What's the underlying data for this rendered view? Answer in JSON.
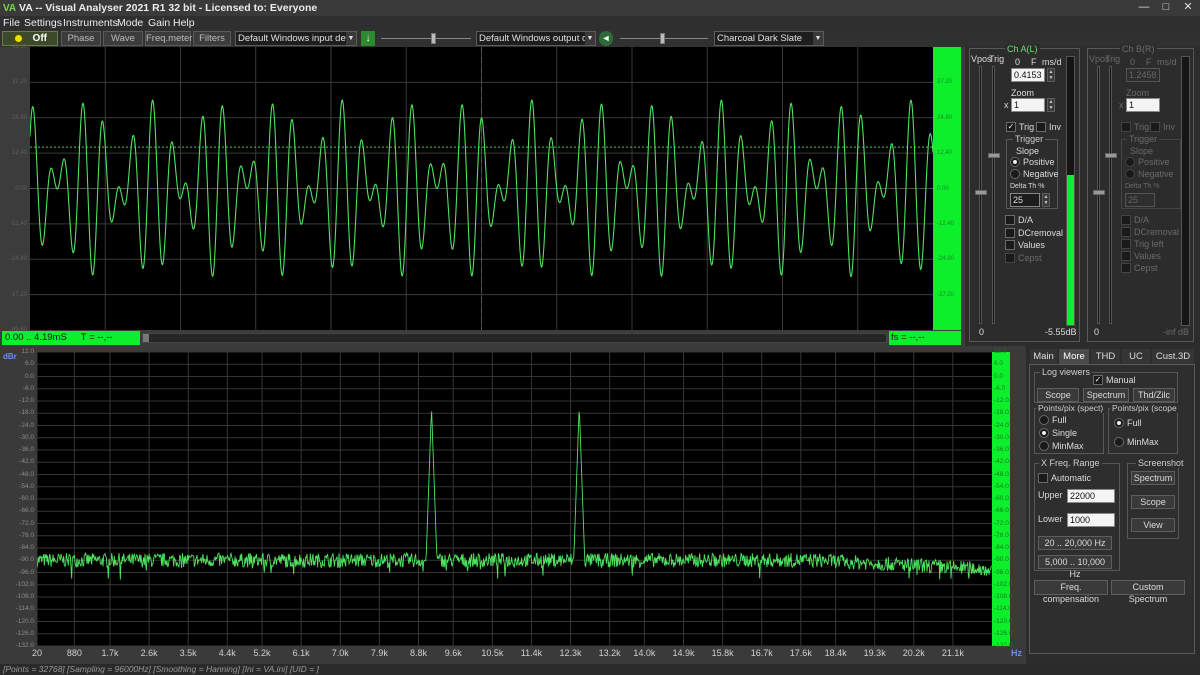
{
  "window": {
    "logo": "VA",
    "title": "VA -- Visual Analyser 2021 R1 32 bit - Licensed to: Everyone",
    "min": "—",
    "max": "□",
    "close": "✕"
  },
  "menu": [
    "File",
    "Settings",
    "Instruments",
    "Mode",
    "Gain",
    "Help"
  ],
  "toolbar": {
    "power_label": "Off",
    "tabs": [
      "Phase",
      "Wave",
      "Freq.meter",
      "Filters"
    ],
    "input_device": "Default Windows input device",
    "output_device": "Default Windows output devic",
    "theme": "Charcoal Dark Slate"
  },
  "scope": {
    "y_ticks": [
      "49.60",
      "37.20",
      "24.80",
      "12.40",
      "0.00",
      "-12.40",
      "-24.80",
      "-37.20",
      "-49.60"
    ],
    "status_time": "0.00 .. 4.19mS",
    "status_period": "T = --,--",
    "status_freq": "fs = --,--"
  },
  "spectrum": {
    "unit_left": "dBr",
    "unit_hz": "Hz",
    "y_ticks": [
      "12.0",
      "6.0",
      "0.0",
      "-6.0",
      "-12.0",
      "-18.0",
      "-24.0",
      "-30.0",
      "-36.0",
      "-42.0",
      "-48.0",
      "-54.0",
      "-60.0",
      "-66.0",
      "-72.0",
      "-78.0",
      "-84.0",
      "-90.0",
      "-96.0",
      "-102.0",
      "-108.0",
      "-114.0",
      "-120.0",
      "-126.0",
      "-132.0"
    ],
    "x_ticks": [
      "20",
      "880",
      "1.7k",
      "2.6k",
      "3.5k",
      "4.4k",
      "5.2k",
      "6.1k",
      "7.0k",
      "7.9k",
      "8.8k",
      "9.6k",
      "10.5k",
      "11.4k",
      "12.3k",
      "13.2k",
      "14.0k",
      "14.9k",
      "15.8k",
      "16.7k",
      "17.6k",
      "18.4k",
      "19.3k",
      "20.2k",
      "21.1k"
    ]
  },
  "chart_data": [
    {
      "type": "line",
      "title": "",
      "xlabel": "",
      "ylabel": "",
      "x_range_ms": [
        0,
        4.19
      ],
      "ylim": [
        -49.6,
        49.6
      ],
      "trigger_level": 14.5,
      "tone_frequencies_hz": [
        9100,
        12500
      ]
    },
    {
      "type": "line",
      "title": "",
      "xlabel": "Hz",
      "ylabel": "dBr",
      "xlim": [
        20,
        22000
      ],
      "ylim": [
        -132,
        12
      ],
      "noise_floor_dbr": -90,
      "peaks": [
        {
          "x": 9100,
          "y": -15
        },
        {
          "x": 12500,
          "y": -14
        }
      ]
    }
  ],
  "chA": {
    "title": "Ch A(L)",
    "vpos": "Vpos",
    "trig": "Trig",
    "ms_label": "ms/d",
    "ms_value": "0.4153",
    "zoom_label": "Zoom",
    "x": "x",
    "zoom_value": "1",
    "trig_cb": "Trig",
    "inv_cb": "Inv",
    "trigger_group": "Trigger",
    "slope": "Slope",
    "positive": "Positive",
    "negative": "Negative",
    "deltath": "Delta Th %",
    "deltath_value": "25",
    "da": "D/A",
    "dcremoval": "DCremoval",
    "values": "Values",
    "cepst": "Cepst",
    "zero": "0",
    "db_readout": "-5.55dB",
    "level_fraction": 0.56
  },
  "chB": {
    "title": "Ch B(R)",
    "vpos": "Vpos",
    "trig": "Trig",
    "ms_label": "ms/d",
    "ms_value": "1.2458",
    "zoom_label": "Zoom",
    "x": "x",
    "zoom_value": "1",
    "trig_cb": "Trig",
    "inv_cb": "Inv",
    "trigger_group": "Trigger",
    "slope": "Slope",
    "positive": "Positive",
    "negative": "Negative",
    "deltath": "Delta Th %",
    "deltath_value": "25",
    "da": "D/A",
    "dcremoval": "DCremoval",
    "trigleft": "Trig left",
    "values": "Values",
    "cepst": "Cepst",
    "zero": "0",
    "db_readout": "-inf dB"
  },
  "tabs": [
    "Main",
    "More",
    "THD",
    "UC",
    "Cust.3D"
  ],
  "more": {
    "log_viewers": "Log viewers",
    "manual": "Manual",
    "scope": "Scope",
    "spectrum": "Spectrum",
    "thd": "Thd/Zilc",
    "ppx_spect": "Points/pix (spect)",
    "ppx_scope": "Points/pix (scope",
    "full": "Full",
    "single": "Single",
    "minmax": "MinMax",
    "full2": "Full",
    "minmax2": "MinMax",
    "xfreq": "X Freq. Range",
    "automatic": "Automatic",
    "upper": "Upper",
    "upper_value": "22000",
    "lower": "Lower",
    "lower_value": "1000",
    "range1": "20 .. 20,000 Hz",
    "range2": "5,000 .. 10,000 Hz",
    "screenshot": "Screenshot",
    "ss_spectrum": "Spectrum",
    "ss_scope": "Scope",
    "ss_view": "View",
    "freq_comp": "Freq. compensation",
    "custom_spectrum": "Custom Spectrum"
  },
  "footer": "[Points = 32768]  [Sampling = 96000Hz]  [Smoothing = Hanning]  [Ini = VA.ini]  [UID = ]"
}
